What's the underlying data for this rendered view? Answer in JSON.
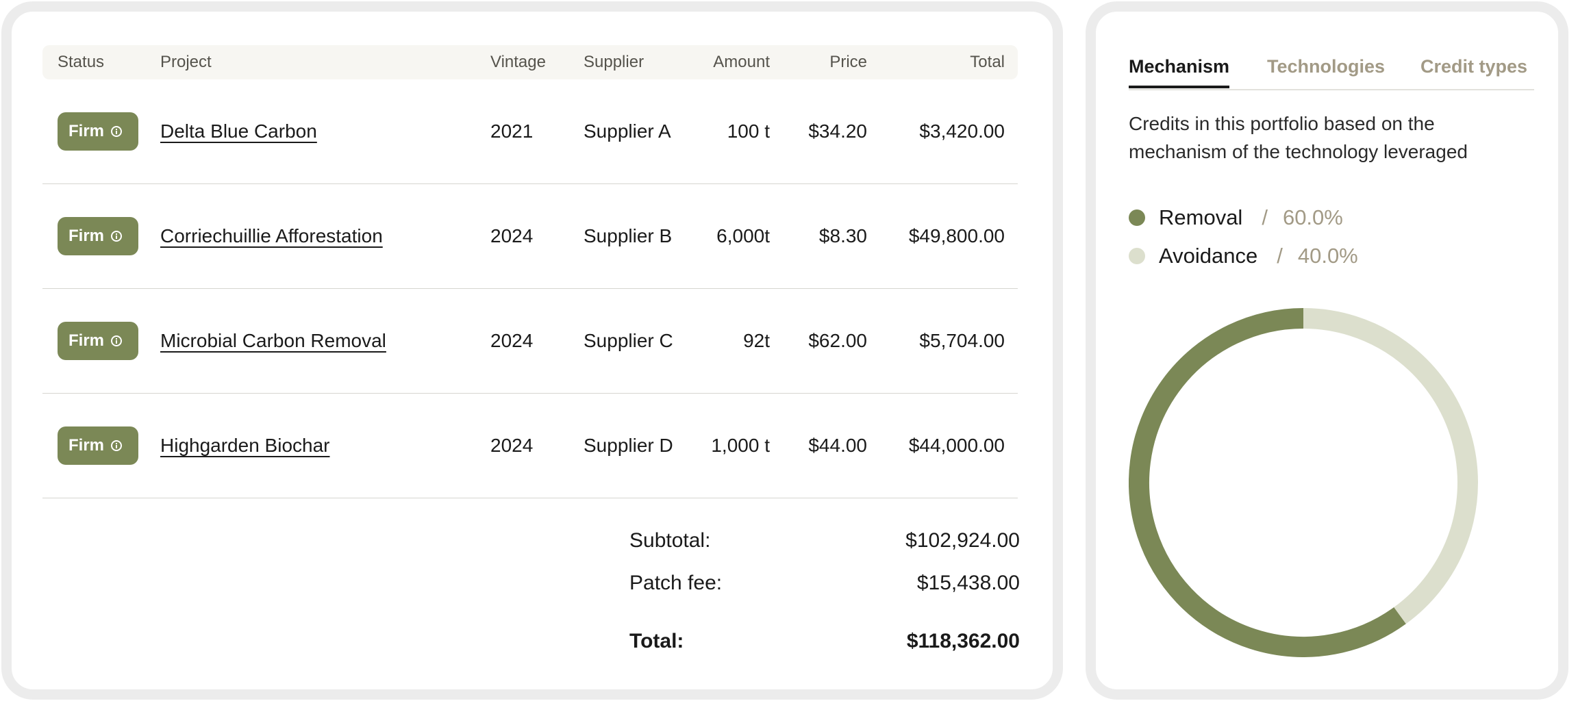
{
  "table": {
    "headers": {
      "status": "Status",
      "project": "Project",
      "vintage": "Vintage",
      "supplier": "Supplier",
      "amount": "Amount",
      "price": "Price",
      "total": "Total"
    },
    "rows": [
      {
        "status": "Firm",
        "project": "Delta Blue Carbon",
        "vintage": "2021",
        "supplier": "Supplier A",
        "amount": "100 t",
        "price": "$34.20",
        "total": "$3,420.00"
      },
      {
        "status": "Firm",
        "project": "Corriechuillie Afforestation",
        "vintage": "2024",
        "supplier": "Supplier B",
        "amount": "6,000t",
        "price": "$8.30",
        "total": "$49,800.00"
      },
      {
        "status": "Firm",
        "project": "Microbial Carbon Removal",
        "vintage": "2024",
        "supplier": "Supplier C",
        "amount": "92t",
        "price": "$62.00",
        "total": "$5,704.00"
      },
      {
        "status": "Firm",
        "project": "Highgarden Biochar",
        "vintage": "2024",
        "supplier": "Supplier D",
        "amount": "1,000 t",
        "price": "$44.00",
        "total": "$44,000.00"
      }
    ]
  },
  "summary": {
    "subtotal_label": "Subtotal:",
    "subtotal_value": "$102,924.00",
    "fee_label": "Patch fee:",
    "fee_value": "$15,438.00",
    "total_label": "Total:",
    "total_value": "$118,362.00"
  },
  "tabs": [
    {
      "label": "Mechanism",
      "active": true
    },
    {
      "label": "Technologies",
      "active": false
    },
    {
      "label": "Credit types",
      "active": false
    }
  ],
  "description": "Credits in this portfolio based on the mechanism of the technology leveraged",
  "legend": [
    {
      "name": "Removal",
      "separator": "/",
      "percent": "60.0%"
    },
    {
      "name": "Avoidance",
      "separator": "/",
      "percent": "40.0%"
    }
  ],
  "colors": {
    "accent": "#7b8856",
    "accent_light": "#dcdfcd",
    "muted_text": "#a29a86",
    "panel_border": "#ececec"
  },
  "icons": {
    "status_info": "info-icon"
  },
  "chart_data": {
    "type": "pie",
    "categories": [
      "Removal",
      "Avoidance"
    ],
    "values": [
      60.0,
      40.0
    ],
    "colors": [
      "#7b8856",
      "#dcdfcd"
    ]
  }
}
